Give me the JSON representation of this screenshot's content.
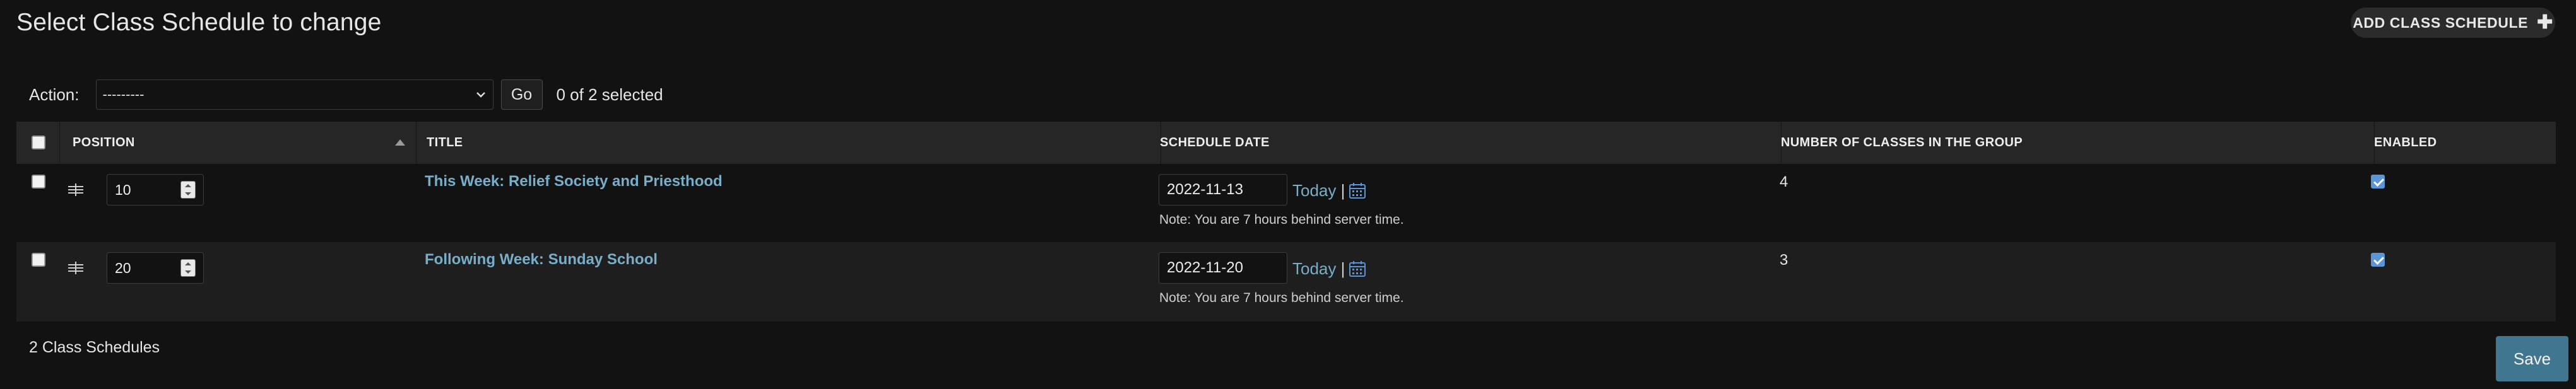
{
  "page": {
    "title": "Select Class Schedule to change"
  },
  "add_button": {
    "label": "ADD CLASS SCHEDULE",
    "icon": "plus-icon"
  },
  "actions": {
    "label": "Action:",
    "selected_option": "---------",
    "go_label": "Go",
    "selection_count": "0 of 2 selected"
  },
  "table": {
    "columns": {
      "position": "POSITION",
      "title": "TITLE",
      "schedule_date": "SCHEDULE DATE",
      "num_classes": "NUMBER OF CLASSES IN THE GROUP",
      "enabled": "ENABLED"
    },
    "rows": [
      {
        "position": "10",
        "title": "This Week: Relief Society and Priesthood",
        "schedule_date": "2022-11-13",
        "today_label": "Today",
        "separator": "|",
        "note": "Note: You are 7 hours behind server time.",
        "num_classes": "4",
        "enabled": true
      },
      {
        "position": "20",
        "title": "Following Week: Sunday School",
        "schedule_date": "2022-11-20",
        "today_label": "Today",
        "separator": "|",
        "note": "Note: You are 7 hours behind server time.",
        "num_classes": "3",
        "enabled": true
      }
    ]
  },
  "footer": {
    "count": "2 Class Schedules",
    "save_label": "Save"
  },
  "colors": {
    "link": "#79aec8",
    "save_button": "#417690",
    "checkbox_checked": "#5b95d8",
    "background": "#121212"
  }
}
